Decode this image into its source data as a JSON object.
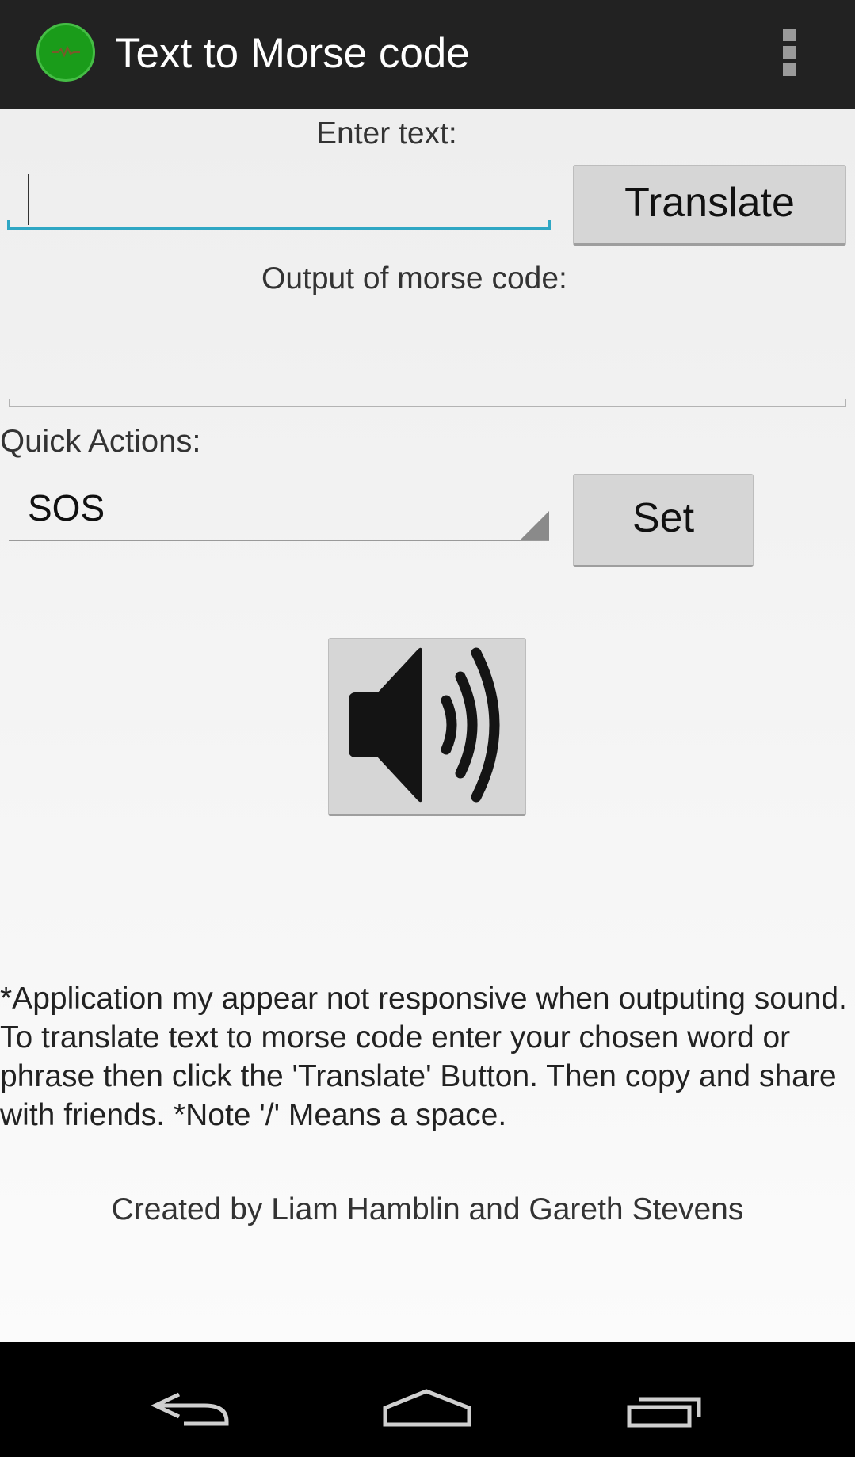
{
  "action_bar": {
    "title": "Text to Morse code",
    "icon": "app-logo-icon",
    "menu_icon": "overflow-menu-icon"
  },
  "form": {
    "enter_text_label": "Enter text:",
    "input_value": "",
    "translate_label": "Translate",
    "output_label": "Output of morse code:",
    "output_value": "",
    "quick_actions_label": "Quick Actions:",
    "quick_action_selected": "SOS",
    "set_label": "Set",
    "play_icon": "speaker-icon"
  },
  "info": {
    "note": "*Application my appear not responsive when outputing sound. To translate text to morse code enter your chosen word or phrase then click the 'Translate' Button. Then copy and share with friends. *Note '/' Means a space.",
    "credits": "Created by Liam Hamblin and Gareth Stevens"
  },
  "nav": {
    "back_icon": "back-icon",
    "home_icon": "home-icon",
    "recents_icon": "recent-apps-icon"
  },
  "colors": {
    "action_bar": "#222222",
    "accent": "#2fa7c4",
    "icon_green": "#1a9c1a",
    "button": "#d6d6d6"
  }
}
